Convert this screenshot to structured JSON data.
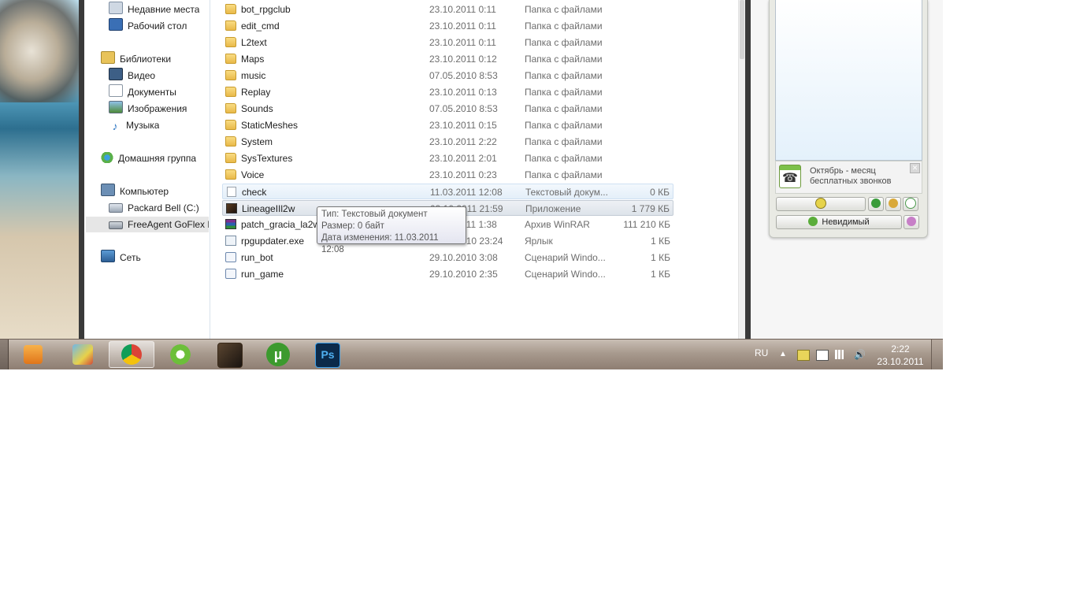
{
  "nav": {
    "items": [
      {
        "label": "Недавние места",
        "icon": "recent-places-icon"
      },
      {
        "label": "Рабочий стол",
        "icon": "desktop-icon"
      },
      {
        "label": "Библиотеки",
        "icon": "libraries-icon"
      },
      {
        "label": "Видео",
        "icon": "video-icon"
      },
      {
        "label": "Документы",
        "icon": "documents-icon"
      },
      {
        "label": "Изображения",
        "icon": "pictures-icon"
      },
      {
        "label": "Музыка",
        "icon": "music-icon"
      },
      {
        "label": "Домашняя группа",
        "icon": "homegroup-icon"
      },
      {
        "label": "Компьютер",
        "icon": "computer-icon"
      },
      {
        "label": "Packard Bell (C:)",
        "icon": "drive-icon"
      },
      {
        "label": "FreeAgent GoFlex Dr",
        "icon": "usb-drive-icon"
      },
      {
        "label": "Сеть",
        "icon": "network-icon"
      }
    ]
  },
  "files": [
    {
      "name": "bot_rpgclub",
      "date": "23.10.2011 0:11",
      "type": "Папка с файлами",
      "size": "",
      "icon": "folder-icon"
    },
    {
      "name": "edit_cmd",
      "date": "23.10.2011 0:11",
      "type": "Папка с файлами",
      "size": "",
      "icon": "folder-icon"
    },
    {
      "name": "L2text",
      "date": "23.10.2011 0:11",
      "type": "Папка с файлами",
      "size": "",
      "icon": "folder-icon"
    },
    {
      "name": "Maps",
      "date": "23.10.2011 0:12",
      "type": "Папка с файлами",
      "size": "",
      "icon": "folder-icon"
    },
    {
      "name": "music",
      "date": "07.05.2010 8:53",
      "type": "Папка с файлами",
      "size": "",
      "icon": "folder-icon"
    },
    {
      "name": "Replay",
      "date": "23.10.2011 0:13",
      "type": "Папка с файлами",
      "size": "",
      "icon": "folder-icon"
    },
    {
      "name": "Sounds",
      "date": "07.05.2010 8:53",
      "type": "Папка с файлами",
      "size": "",
      "icon": "folder-icon"
    },
    {
      "name": "StaticMeshes",
      "date": "23.10.2011 0:15",
      "type": "Папка с файлами",
      "size": "",
      "icon": "folder-icon"
    },
    {
      "name": "System",
      "date": "23.10.2011 2:22",
      "type": "Папка с файлами",
      "size": "",
      "icon": "folder-icon"
    },
    {
      "name": "SysTextures",
      "date": "23.10.2011 2:01",
      "type": "Папка с файлами",
      "size": "",
      "icon": "folder-icon"
    },
    {
      "name": "Voice",
      "date": "23.10.2011 0:23",
      "type": "Папка с файлами",
      "size": "",
      "icon": "folder-icon"
    },
    {
      "name": "check",
      "date": "11.03.2011 12:08",
      "type": "Текстовый докум...",
      "size": "0 КБ",
      "icon": "text-file-icon"
    },
    {
      "name": "LineageIIl2w",
      "date": "03.10.2011 21:59",
      "type": "Приложение",
      "size": "1 779 КБ",
      "icon": "application-icon"
    },
    {
      "name": "patch_gracia_la2w",
      "date": "03.10.2011 1:38",
      "type": "Архив WinRAR",
      "size": "111 210 КБ",
      "icon": "winrar-archive-icon"
    },
    {
      "name": "rpgupdater.exe",
      "date": "03.10.2010 23:24",
      "type": "Ярлык",
      "size": "1 КБ",
      "icon": "shortcut-icon"
    },
    {
      "name": "run_bot",
      "date": "29.10.2010 3:08",
      "type": "Сценарий Windo...",
      "size": "1 КБ",
      "icon": "script-icon"
    },
    {
      "name": "run_game",
      "date": "29.10.2010 2:35",
      "type": "Сценарий Windo...",
      "size": "1 КБ",
      "icon": "script-icon"
    }
  ],
  "tooltip": {
    "type": "Тип: Текстовый документ",
    "size": "Размер: 0 байт",
    "modified": "Дата изменения: 11.03.2011 12:08"
  },
  "icq": {
    "promo_text": "Октябрь - месяц бесплатных звонков",
    "status_button": "Невидимый"
  },
  "taskbar": {
    "apps": [
      {
        "icon": "media-player-icon"
      },
      {
        "icon": "paint-icon"
      },
      {
        "icon": "chrome-icon"
      },
      {
        "icon": "icq-icon"
      },
      {
        "icon": "lineage-game-icon"
      },
      {
        "icon": "utorrent-icon"
      },
      {
        "icon": "photoshop-icon"
      }
    ],
    "language": "RU",
    "time": "2:22",
    "date": "23.10.2011"
  },
  "colors": {
    "accent": "#3399ff",
    "taskbar": "#a89a8e",
    "folder": "#e9b949"
  }
}
